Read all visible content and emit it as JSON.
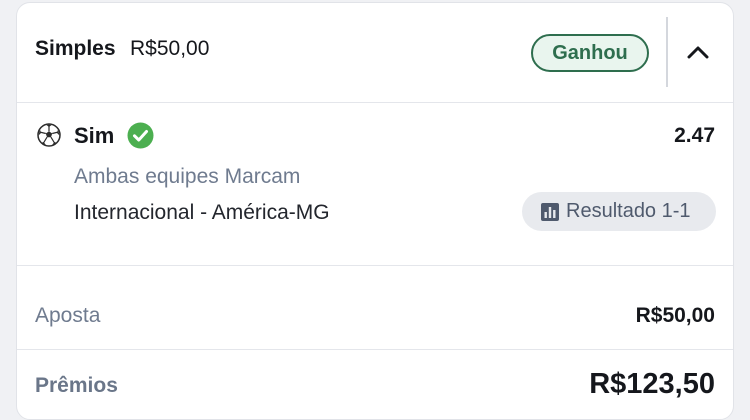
{
  "header": {
    "bet_type": "Simples",
    "bet_amount": "R$50,00",
    "status": "Ganhou"
  },
  "selection": {
    "sport_icon": "soccer-ball-icon",
    "pick": "Sim",
    "pick_status_icon": "check-circle-icon",
    "odds": "2.47",
    "market": "Ambas equipes Marcam",
    "event": "Internacional - América-MG",
    "result_icon": "bar-chart-icon",
    "result": "Resultado 1-1"
  },
  "summary": {
    "stake_label": "Aposta",
    "stake_value": "R$50,00",
    "prize_label": "Prêmios",
    "prize_value": "R$123,50"
  },
  "colors": {
    "win_green": "#2e6e4e",
    "check_green": "#4caf50",
    "muted_text": "#6f7b8f"
  }
}
